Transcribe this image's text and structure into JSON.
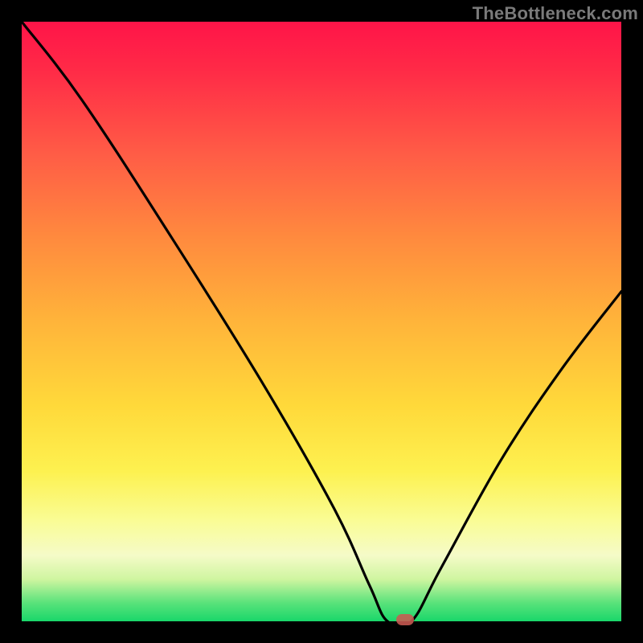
{
  "watermark": "TheBottleneck.com",
  "colors": {
    "frame": "#000000",
    "curve": "#000000",
    "marker": "#ca5a52",
    "gradient_top": "#ff1448",
    "gradient_bottom": "#19d76a"
  },
  "chart_data": {
    "type": "line",
    "title": "",
    "xlabel": "",
    "ylabel": "",
    "xlim": [
      0,
      100
    ],
    "ylim": [
      0,
      100
    ],
    "notes": "Bottleneck-style V-curve over a vertical red→green heat gradient. No axis ticks or labels are shown; x and y are normalized 0–100 left→right and bottom→top. Minimum (flat green zone) is roughly x≈61–65 at y≈0.",
    "series": [
      {
        "name": "curve",
        "x": [
          0,
          10,
          25,
          40,
          52,
          58,
          61,
          65,
          70,
          80,
          90,
          100
        ],
        "values": [
          100,
          87,
          64,
          40,
          19,
          6,
          0,
          0,
          9,
          27,
          42,
          55
        ]
      }
    ],
    "marker": {
      "x": 64,
      "y": 0,
      "shape": "rounded-rect"
    }
  }
}
